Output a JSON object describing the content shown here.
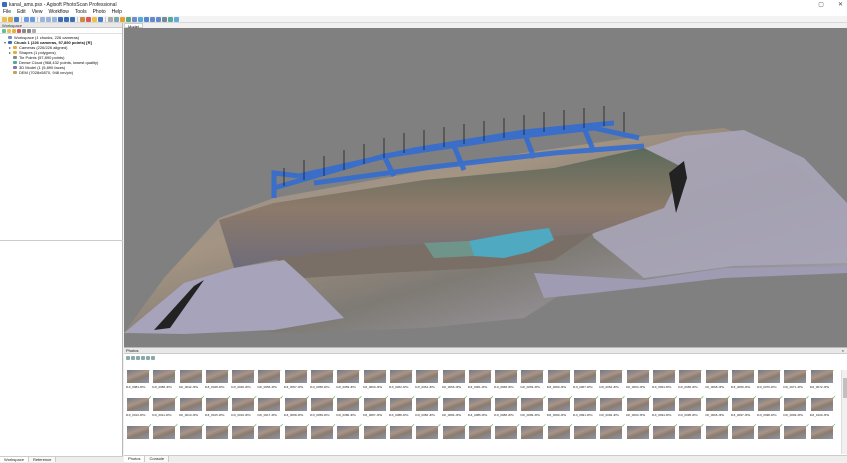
{
  "window": {
    "title": "kanal_ams.psx - Agisoft PhotoScan Professional"
  },
  "menu": [
    "File",
    "Edit",
    "View",
    "Workflow",
    "Tools",
    "Photo",
    "Help"
  ],
  "workspace": {
    "panel_title": "Workspace",
    "tree": [
      {
        "indent": 0,
        "label": "Workspace (1 chunks, 226 cameras)",
        "icon": "workspace-icon",
        "bold": false
      },
      {
        "indent": 0,
        "label": "Chunk 1 (226 cameras, 57,890 points) [R]",
        "icon": "chunk-icon",
        "bold": true
      },
      {
        "indent": 1,
        "label": "Cameras (226/226 aligned)",
        "icon": "folder-icon",
        "bold": false
      },
      {
        "indent": 1,
        "label": "Shapes (1 polygons)",
        "icon": "folder-icon",
        "bold": false
      },
      {
        "indent": 1,
        "label": "Tie Points (57,890 points)",
        "icon": "points-icon",
        "bold": false
      },
      {
        "indent": 1,
        "label": "Dense Cloud (968,432 points, lowest quality)",
        "icon": "dense-cloud-icon",
        "bold": false
      },
      {
        "indent": 1,
        "label": "3D Model (1 (5,890 faces)",
        "icon": "mesh-icon",
        "bold": false
      },
      {
        "indent": 1,
        "label": "DEM (7028x5870, 948 cm/pix)",
        "icon": "dem-icon",
        "bold": false
      }
    ],
    "tabs": [
      "Workspace",
      "Reference"
    ]
  },
  "model": {
    "tab_label": "Model"
  },
  "photos": {
    "panel_title": "Photos",
    "close": "×",
    "tabs": [
      "Photos",
      "Console"
    ],
    "rows": [
      [
        "DJI_0084.JPG",
        "DJI_0086.JPG",
        "DJI_0042.JPG",
        "DJI_0048.JPG",
        "DJI_0046.JPG",
        "DJI_0056.JPG",
        "DJI_0057.JPG",
        "DJI_0058.JPG",
        "DJI_0059.JPG",
        "DJI_0060.JPG",
        "DJI_0062.JPG",
        "DJI_0064.JPG",
        "DJI_0066.JPG",
        "DJI_0061.JPG",
        "DJI_0068.JPG",
        "DJI_0069.JPG",
        "DJI_0060.JPG",
        "DJI_0067.JPG",
        "DJI_0062.JPG",
        "DJI_0063.JPG",
        "DJI_0064.JPG",
        "DJI_0066.JPG",
        "DJI_0068.JPG",
        "DJI_0069.JPG",
        "DJI_0070.JPG",
        "DJI_0071.JPG",
        "DJI_0072.JPG"
      ],
      [
        "DJI_0013.JPG",
        "DJI_0011.JPG",
        "DJI_0010.JPG",
        "DJI_0015.JPG",
        "DJI_0016.JPG",
        "DJI_0017.JPG",
        "DJI_0058.JPG",
        "DJI_0059.JPG",
        "DJI_0080.JPG",
        "DJI_0087.JPG",
        "DJI_0088.JPG",
        "DJI_0086.JPG",
        "DJI_0084.JPG",
        "DJI_0086.JPG",
        "DJI_0088.JPG",
        "DJI_0089.JPG",
        "DJI_0090.JPG",
        "DJI_0091.JPG",
        "DJI_0092.JPG",
        "DJI_0093.JPG",
        "DJI_0094.JPG",
        "DJI_0095.JPG",
        "DJI_0096.JPG",
        "DJI_0097.JPG",
        "DJI_0098.JPG",
        "DJI_0099.JPG",
        "DJI_0100.JPG"
      ],
      [
        "",
        "",
        "",
        "",
        "",
        "",
        "",
        "",
        "",
        "",
        "",
        "",
        "",
        "",
        "",
        "",
        "",
        "",
        "",
        "",
        "",
        "",
        "",
        "",
        "",
        "",
        ""
      ]
    ]
  }
}
